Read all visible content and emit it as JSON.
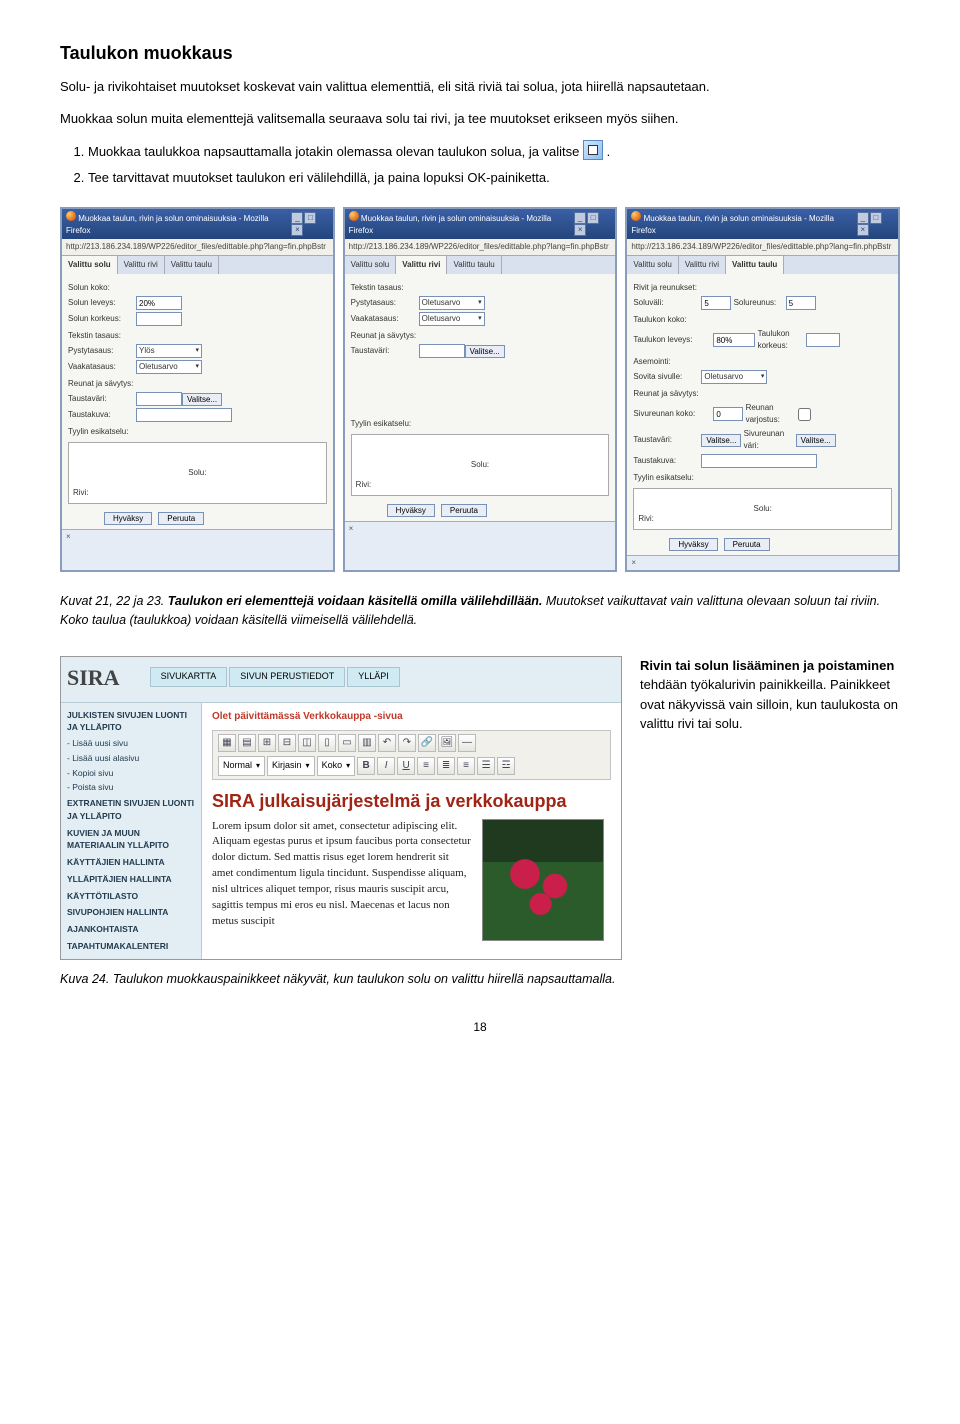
{
  "heading": "Taulukon muokkaus",
  "intro1": "Solu- ja rivikohtaiset muutokset koskevat vain valittua elementtiä, eli sitä riviä tai solua, jota hiirellä napsautetaan.",
  "intro2": "Muokkaa solun muita elementtejä valitsemalla seuraava solu tai rivi, ja tee muutokset erikseen myös siihen.",
  "step1a": "Muokkaa taulukkoa napsauttamalla jotakin olemassa olevan taulukon solua, ja valitse ",
  "step1b": ".",
  "step2": "Tee tarvittavat muutokset taulukon eri välilehdillä, ja paina lopuksi OK-painiketta.",
  "dialog_common": {
    "title": "Muokkaa taulun, rivin ja solun ominaisuuksia - Mozilla Firefox",
    "url": "http://213.186.234.189/WP226/editor_files/edittable.php?lang=fin.phpBstr",
    "close_x": "×",
    "tab_solu": "Valittu solu",
    "tab_rivi": "Valittu rivi",
    "tab_taulu": "Valittu taulu",
    "valitse_btn": "Valitse...",
    "tyylin": "Tyylin esikatselu:",
    "solu": "Solu:",
    "rivi": "Rivi:",
    "hyvaksy": "Hyväksy",
    "peruuta": "Peruuta",
    "footer": "×"
  },
  "dialog1": {
    "solun_koko": "Solun koko:",
    "solun_leveys": "Solun leveys:",
    "solun_korkeus": "Solun korkeus:",
    "leveys_val": "20%",
    "tekstin_tasaus": "Tekstin tasaus:",
    "pystytasaus": "Pystytasaus:",
    "vaakatasaus": "Vaakatasaus:",
    "pysty_val": "Ylös",
    "vaaka_val": "Oletusarvo",
    "reunat": "Reunat ja sävytys:",
    "taustavari": "Taustaväri:",
    "taustakuva": "Taustakuva:"
  },
  "dialog2": {
    "tekstin_tasaus": "Tekstin tasaus:",
    "pystytasaus": "Pystytasaus:",
    "vaakatasaus": "Vaakatasaus:",
    "oletusarvo": "Oletusarvo",
    "reunat": "Reunat ja sävytys:",
    "taustavari": "Taustaväri:"
  },
  "dialog3": {
    "rivit_reunukset": "Rivit ja reunukset:",
    "soluvali": "Soluväli:",
    "solureunus": "Solureunus:",
    "val5": "5",
    "taulukon_koko": "Taulukon koko:",
    "taulukon_leveys": "Taulukon leveys:",
    "taulukon_korkeus": "Taulukon korkeus:",
    "leveys_val": "80%",
    "asemointi": "Asemointi:",
    "sovita": "Sovita sivulle:",
    "oletusarvo": "Oletusarvo",
    "reunat": "Reunat ja sävytys:",
    "sivureunan_koko": "Sivureunan koko:",
    "sivu_val": "0",
    "reunan": "Reunan varjostus:",
    "taustavari": "Taustaväri:",
    "sivureunan_vari": "Sivureunan väri:",
    "taustakuva": "Taustakuva:"
  },
  "caption1_a": "Kuvat 21, 22 ja 23.",
  "caption1_b": "Taulukon eri elementtejä voidaan käsitellä omilla välilehdillään.",
  "caption1_c": " Muutokset vaikuttavat vain valittuna olevaan soluun tai riviin. Koko taulua (taulukkoa) voidaan käsitellä viimeisellä välilehdellä.",
  "aside1a": "Rivin tai solun lisääminen ja poistaminen",
  "aside1b": " tehdään työkalurivin painikkeilla. Painikkeet ovat näkyvissä vain silloin, kun taulukosta on valittu rivi tai solu.",
  "fig": {
    "sira": "SIRA",
    "tab_sivukartta": "SIVUKARTTA",
    "tab_perus": "SIVUN PERUSTIEDOT",
    "tab_yllapi": "YLLÄPI",
    "sb_julk": "JULKISTEN SIVUJEN LUONTI JA YLLÄPITO",
    "sb_lisaa_sivu": "- Lisää uusi sivu",
    "sb_lisaa_ala": "- Lisää uusi alasivu",
    "sb_kopioi": "- Kopioi sivu",
    "sb_poista": "- Poista sivu",
    "sb_extranet": "EXTRANETIN SIVUJEN LUONTI JA YLLÄPITO",
    "sb_kuvien": "KUVIEN JA MUUN MATERIAALIN YLLÄPITO",
    "sb_kayt": "KÄYTTÄJIEN HALLINTA",
    "sb_yllap": "YLLÄPITÄJIEN HALLINTA",
    "sb_kayttil": "KÄYTTÖTILASTO",
    "sb_sivup": "SIVUPOHJIEN HALLINTA",
    "sb_ajan": "AJANKOHTAISTA",
    "sb_tap": "TAPAHTUMAKALENTERI",
    "olet_a": "Olet päivittämässä ",
    "olet_b": "Verkkokauppa",
    "olet_c": " -sivua",
    "dd_normal": "Normal",
    "dd_kirjasin": "Kirjasin",
    "dd_koko": "Koko",
    "b": "B",
    "i": "I",
    "u": "U",
    "article_title": "SIRA julkaisujärjestelmä ja verkkokauppa",
    "article_text": "Lorem ipsum dolor sit amet, consectetur adipiscing elit. Aliquam egestas purus et ipsum faucibus porta consectetur dolor dictum. Sed mattis risus eget lorem hendrerit sit amet condimentum ligula tincidunt. Suspendisse aliquam, nisl ultrices aliquet tempor, risus mauris suscipit arcu, sagittis tempus mi eros eu nisl. Maecenas et lacus non metus suscipit"
  },
  "caption2a": "Kuva 24. Taulukon muokkauspainikkeet näkyvät, kun taulukon solu on valittu hiirellä napsauttamalla.",
  "page_num": "18"
}
